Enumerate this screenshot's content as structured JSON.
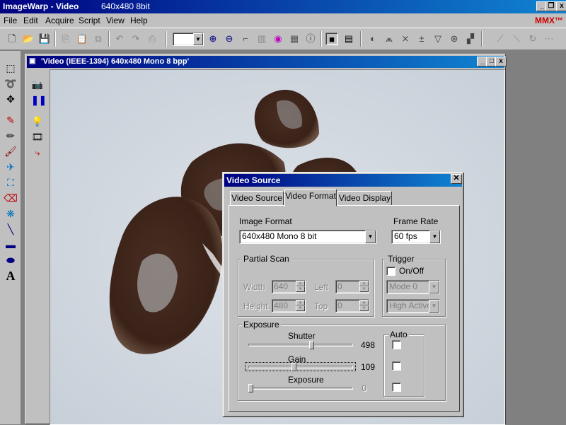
{
  "app": {
    "title": "ImageWarp - Video",
    "subtitle": "640x480 8bit"
  },
  "menu": [
    "File",
    "Edit",
    "Acquire",
    "Script",
    "View",
    "Help"
  ],
  "mmx_label": "MMX™",
  "child_window": {
    "title": "'Video (IEEE-1394) 640x480 Mono 8 bpp'"
  },
  "dialog": {
    "title": "Video Source",
    "close": "✕",
    "tabs": [
      "Video Source",
      "Video Format",
      "Video Display"
    ],
    "active_tab": "Video Format",
    "image_format": {
      "label": "Image Format",
      "value": "640x480 Mono 8 bit"
    },
    "frame_rate": {
      "label": "Frame Rate",
      "value": "60 fps"
    },
    "partial_scan": {
      "label": "Partial Scan",
      "width_label": "Width",
      "width": "640",
      "height_label": "Height",
      "height": "480",
      "left_label": "Left",
      "left": "0",
      "top_label": "Top",
      "top": "0"
    },
    "trigger": {
      "label": "Trigger",
      "onoff_label": "On/Off",
      "mode": "Mode 0",
      "polarity": "High Active"
    },
    "exposure": {
      "label": "Exposure",
      "auto_label": "Auto",
      "shutter": {
        "label": "Shutter",
        "value": "498",
        "fraction": 0.61
      },
      "gain": {
        "label": "Gain",
        "value": "109",
        "fraction": 0.43
      },
      "exposure": {
        "label": "Exposure",
        "value": "0",
        "fraction": 0.0
      }
    }
  }
}
